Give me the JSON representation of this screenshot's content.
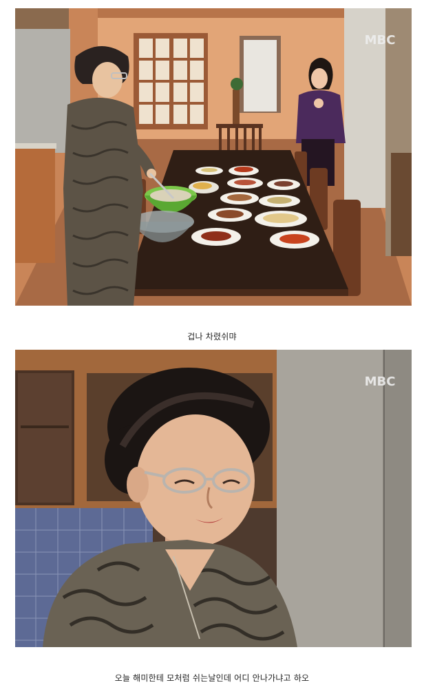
{
  "panels": [
    {
      "watermark": "MBC",
      "caption": "겁나 차렸쉬먀"
    },
    {
      "watermark": "MBC",
      "caption": "오늘 해미한테 모처럼 쉬는날인데 어디 안나가냐고 하오"
    }
  ],
  "colors": {
    "page_background": "#ffffff",
    "caption_text": "#222222",
    "wall_orange": "#d99a6c",
    "wood_dark": "#6b3a22",
    "table_top": "#3a2418",
    "watermark": "#e8e8e8"
  }
}
